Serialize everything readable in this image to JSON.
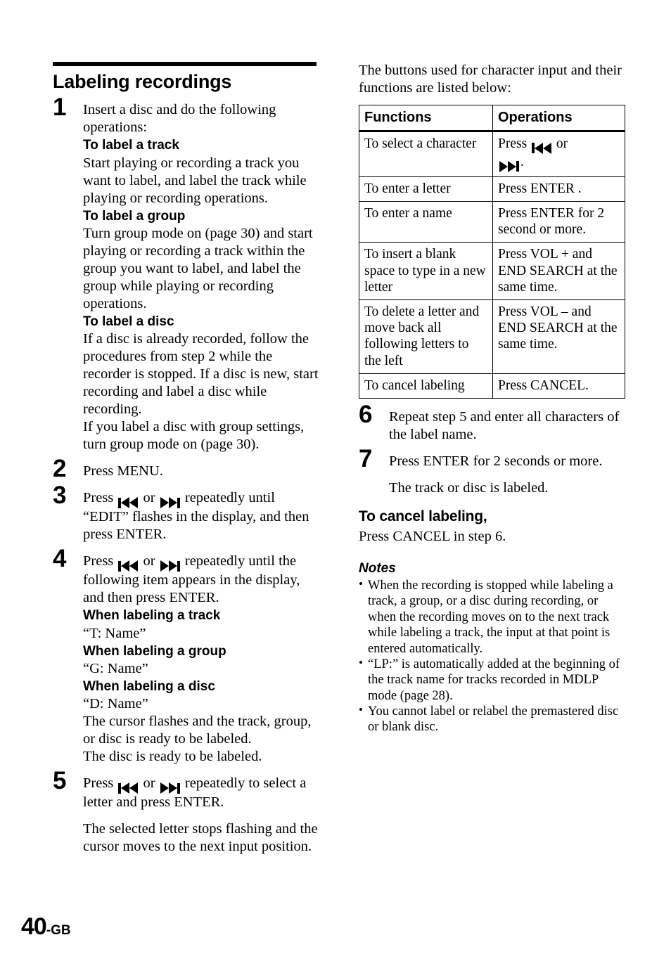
{
  "page": {
    "number": "40",
    "suffix": "-GB"
  },
  "left": {
    "section_title": "Labeling recordings",
    "steps": [
      {
        "num": "1",
        "lines": [
          "Insert a disc and do the following operations:"
        ],
        "blocks": [
          {
            "head": "To label a track",
            "text": "Start playing or recording a track you want to label, and label the track while playing or recording operations."
          },
          {
            "head": "To label a group",
            "text": "Turn group mode on (page 30) and start playing or recording a track within the group you want to label, and label the group while playing or recording operations."
          },
          {
            "head": "To label a disc",
            "text": "If a disc is already recorded, follow the procedures from step 2 while the recorder is stopped. If a disc is new, start recording and label a disc while recording.",
            "text2": "If you label a disc with group settings, turn group mode on (page 30)."
          }
        ]
      },
      {
        "num": "2",
        "text": "Press MENU."
      },
      {
        "num": "3",
        "pre": "Press ",
        "mid": " or ",
        "post": " repeatedly until “EDIT” flashes in the display, and then press ENTER."
      },
      {
        "num": "4",
        "pre": "Press ",
        "mid": " or ",
        "post": " repeatedly until the following item appears in the display, and then press ENTER.",
        "blocks": [
          {
            "head": "When labeling a track",
            "text": "“T: Name”"
          },
          {
            "head": "When labeling a group",
            "text": "“G: Name”"
          },
          {
            "head": "When labeling a disc",
            "text": "“D: Name”"
          }
        ],
        "tail1": "The cursor flashes and the track, group, or disc is ready to be labeled.",
        "tail2": "The disc is ready to be labeled."
      },
      {
        "num": "5",
        "pre": "Press ",
        "mid": " or ",
        "post": " repeatedly to select a letter and press ENTER.",
        "extra": "The selected letter stops flashing and the cursor moves to the next input position."
      }
    ]
  },
  "right": {
    "intro": "The buttons used for character input and their functions are listed below:",
    "table": {
      "headers": [
        "Functions",
        "Operations"
      ],
      "rows": [
        {
          "function": "To select a character",
          "op_pre": "Press ",
          "op_mid": " or ",
          "op_post": "."
        },
        {
          "function": "To enter a letter",
          "operation": "Press ENTER ."
        },
        {
          "function": "To enter a name",
          "operation": "Press ENTER for 2 second or more."
        },
        {
          "function": "To insert a blank space to type in a new letter",
          "operation": " Press VOL + and END SEARCH at the same time."
        },
        {
          "function": "To delete a letter and move back all following letters to the left",
          "operation": "Press VOL – and END SEARCH at the same time."
        },
        {
          "function": "To cancel labeling",
          "operation": "Press CANCEL."
        }
      ]
    },
    "steps": [
      {
        "num": "6",
        "text": "Repeat step 5 and enter all characters of the label name."
      },
      {
        "num": "7",
        "text": "Press ENTER for 2 seconds or more.",
        "extra": "The track or disc is labeled."
      }
    ],
    "cancel_head": "To cancel labeling,",
    "cancel_body": "Press CANCEL in step 6.",
    "notes_head": "Notes",
    "notes": [
      "When the recording is stopped while labeling a track, a group, or a disc during recording, or when the recording moves on to the next track while labeling a track, the input at that point is entered automatically.",
      "“LP:” is automatically added at the beginning of the track name for tracks recorded in MDLP mode (page 28).",
      "You cannot label or relabel the premastered disc or blank disc."
    ]
  },
  "icons": {
    "rewind": "rewind-icon",
    "fast_forward": "fast-forward-icon"
  }
}
